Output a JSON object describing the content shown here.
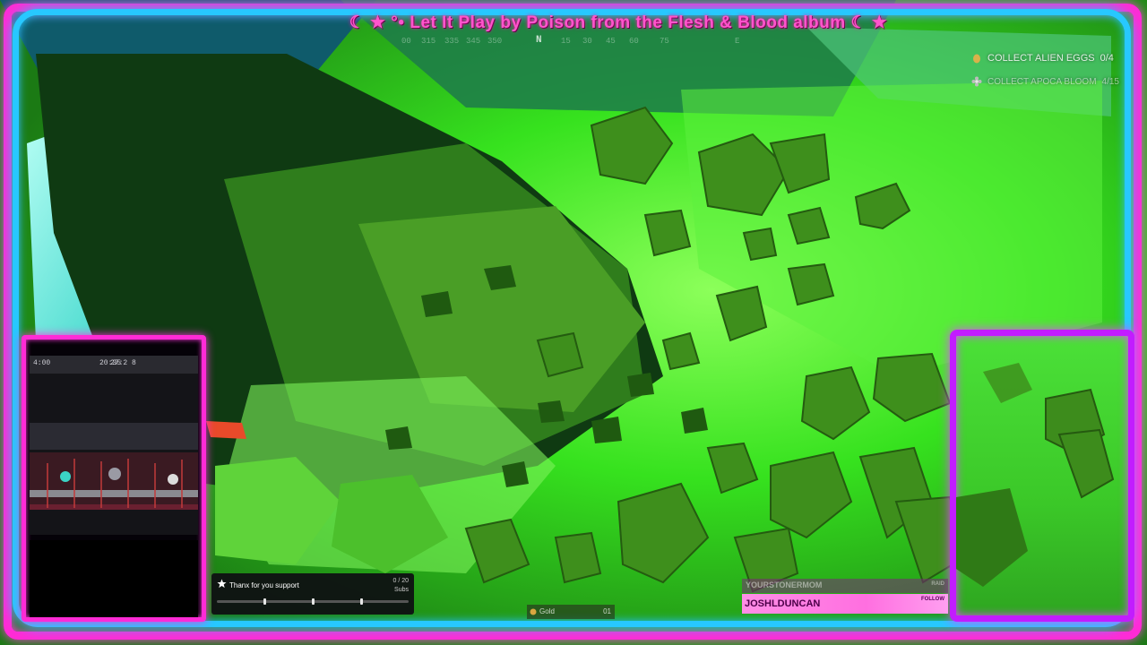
{
  "ticker": {
    "text": "☾ ★ °• Let It Play by Poison from the Flesh & Blood album ☾ ★"
  },
  "compass": {
    "marks": [
      "00",
      "315",
      "335",
      "345",
      "350",
      "N",
      "15",
      "30",
      "45",
      "60",
      "75",
      "E"
    ]
  },
  "objectives": [
    {
      "label": "COLLECT ALIEN EGGS",
      "progress": "0/4",
      "icon": "egg-icon"
    },
    {
      "label": "COLLECT APOCA BLOOM",
      "progress": "4/15",
      "icon": "flower-icon"
    }
  ],
  "capture": {
    "clock": "20:35",
    "left_text": "4:00",
    "right_text": "27:2 8"
  },
  "subgoal": {
    "title": "Thanx for you support",
    "count": "0 / 20",
    "unit": "Subs",
    "progress": 0
  },
  "gold": {
    "label": "Gold",
    "value": "01"
  },
  "follow": {
    "previous_name": "YOURSTONERMOM",
    "previous_tag": "RAID",
    "name": "JOSHLDUNCAN",
    "tag": "FOLLOW"
  },
  "colors": {
    "frame_outer": "#ff2bd6",
    "frame_inner": "#27c8ff",
    "ticker": "#ff55cc",
    "cam_right": "#c21cff",
    "follow_bar": "#ff6fe0"
  }
}
